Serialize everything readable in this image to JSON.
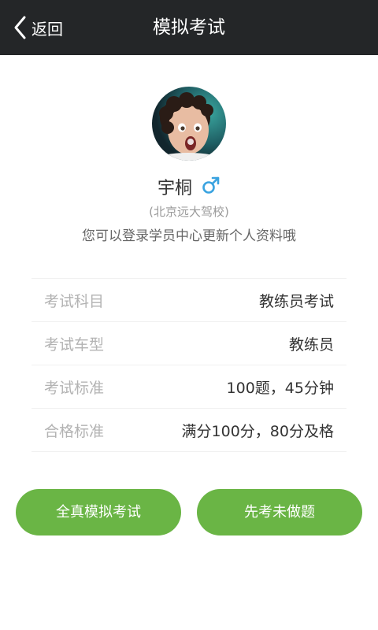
{
  "header": {
    "back_label": "返回",
    "title": "模拟考试"
  },
  "profile": {
    "name": "宇桐",
    "gender_icon": "male-symbol-icon",
    "school": "(北京远大驾校)",
    "hint": "您可以登录学员中心更新个人资料哦"
  },
  "info_rows": [
    {
      "label": "考试科目",
      "value": "教练员考试"
    },
    {
      "label": "考试车型",
      "value": "教练员"
    },
    {
      "label": "考试标准",
      "value": "100题，45分钟"
    },
    {
      "label": "合格标准",
      "value": "满分100分，80分及格"
    }
  ],
  "buttons": {
    "full_exam": "全真模拟考试",
    "practice_unanswered": "先考未做题"
  },
  "colors": {
    "header_bg": "#242628",
    "button_green": "#6ab545",
    "gender_blue": "#3aa3e0"
  }
}
